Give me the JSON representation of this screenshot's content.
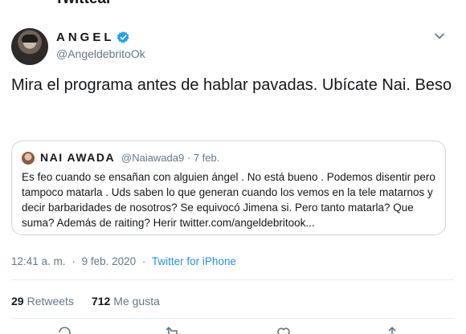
{
  "page": {
    "title": "Twittear"
  },
  "tweet": {
    "author": {
      "display_name": "ANGEL",
      "handle": "@AngeldebritoOk",
      "verified": true
    },
    "text": "Mira el programa antes de hablar pavadas. Ubícate Nai. Beso",
    "quoted": {
      "author_name": "NAI AWADA",
      "handle": "@Naiawada9",
      "separator": "·",
      "date": "7 feb.",
      "text": "Es feo cuando se ensañan con alguien ángel . No está bueno . Podemos disentir pero tampoco matarla . Uds saben lo que generan cuando los vemos en la tele matarnos y decir barbaridades de nosotros? Se equivocó Jimena si. Pero tanto matarla? Que suma? Además de raiting? Herir twitter.com/angeldebritook..."
    },
    "time": "12:41 a. m.",
    "separator": "·",
    "date": "9 feb. 2020",
    "client": "Twitter for iPhone",
    "stats": {
      "retweets_count": "29",
      "retweets_label": "Retweets",
      "likes_count": "712",
      "likes_label": "Me gusta"
    }
  },
  "icons": {
    "verified": "verified-badge-icon",
    "caret": "chevron-down-icon",
    "reply": "reply-icon",
    "retweet": "retweet-icon",
    "like": "heart-icon",
    "share": "share-icon"
  },
  "colors": {
    "accent": "#1b95e0",
    "secondary_text": "#657786",
    "border": "#ccd6dd",
    "text": "#14171a"
  }
}
